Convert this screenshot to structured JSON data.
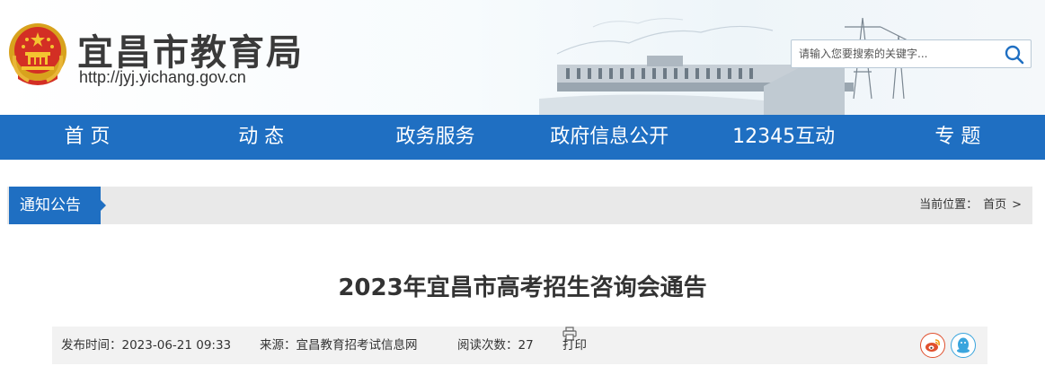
{
  "header": {
    "title": "宜昌市教育局",
    "url": "http://jyj.yichang.gov.cn"
  },
  "search": {
    "placeholder": "请输入您要搜索的关键字..."
  },
  "nav": {
    "items": [
      "首 页",
      "动 态",
      "政务服务",
      "政府信息公开",
      "12345互动",
      "专 题"
    ]
  },
  "channel": {
    "tab_label": "通知公告",
    "crumb_prefix": "当前位置：",
    "crumb_home": "首页",
    "crumb_sep": ">"
  },
  "article": {
    "title": "2023年宜昌市高考招生咨询会通告",
    "date": "发布时间：2023-06-21 09:33",
    "source": "来源：宜昌教育招考试信息网",
    "reads": "阅读次数：27",
    "print_label": "打印"
  },
  "icons": {
    "emblem": "national-emblem-icon",
    "search": "search-icon",
    "print": "printer-icon",
    "weibo": "weibo-icon",
    "qq": "qq-icon"
  },
  "colors": {
    "primary": "#1f6fc2",
    "weibo": "#e0502e",
    "qq": "#3aa5dd"
  }
}
